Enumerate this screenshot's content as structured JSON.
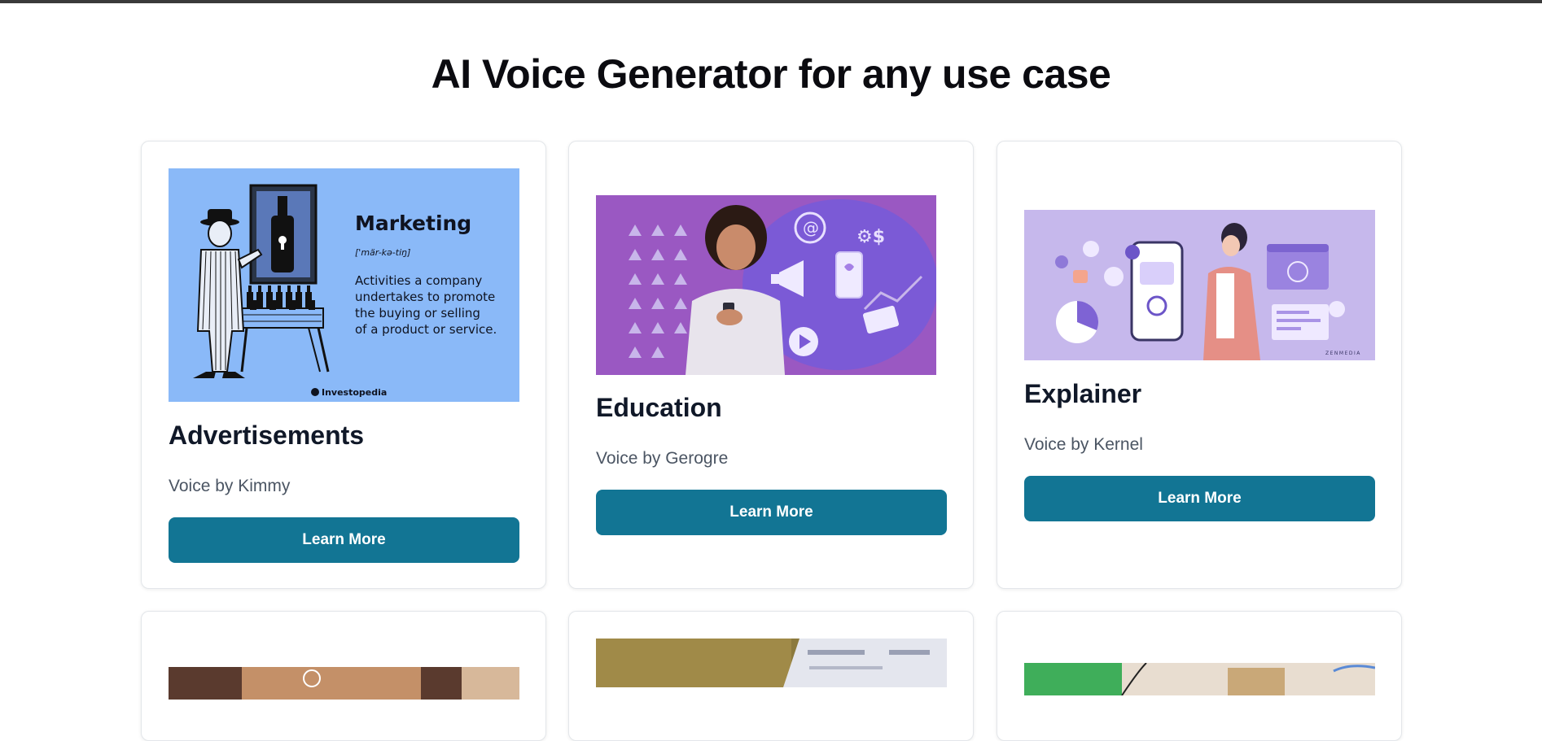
{
  "page": {
    "title": "AI Voice Generator for any use case"
  },
  "cards": [
    {
      "title": "Advertisements",
      "voice": "Voice by Kimmy",
      "button": "Learn More",
      "image": {
        "heading": "Marketing",
        "phonetic": "['mär-kə-tiŋ]",
        "definition": [
          "Activities a company",
          "undertakes to promote",
          "the buying or selling",
          "of a product or service."
        ],
        "brand": "Investopedia"
      }
    },
    {
      "title": "Education",
      "voice": "Voice by Gerogre",
      "button": "Learn More"
    },
    {
      "title": "Explainer",
      "voice": "Voice by Kernel",
      "button": "Learn More",
      "image": {
        "brand": "ZENMEDIA"
      }
    }
  ],
  "colors": {
    "button": "#127594",
    "marketing_bg": "#8ab9f8",
    "education_bg": "#9a58c2",
    "explainer_bg": "#c6b8ec"
  }
}
